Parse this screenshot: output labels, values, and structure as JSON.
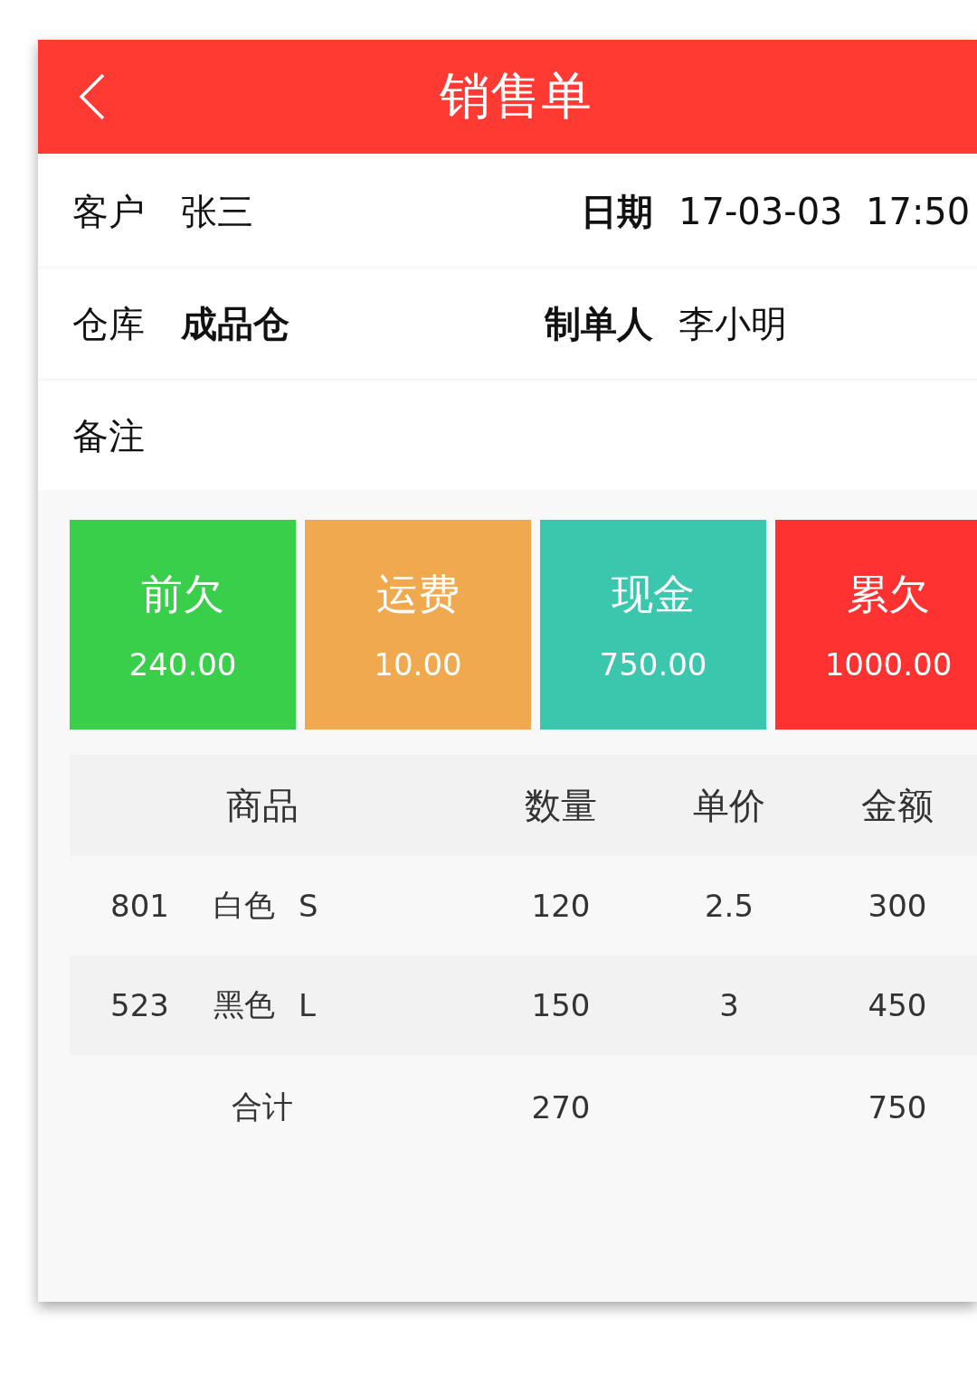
{
  "header": {
    "title": "销售单"
  },
  "info_rows": [
    {
      "left_label": "客户",
      "left_value": "张三",
      "right_label": "日期",
      "right_value": "17-03-03  17:50"
    },
    {
      "left_label": "仓库",
      "left_value": "成品仓",
      "right_label": "制单人",
      "right_value": "李小明"
    },
    {
      "left_label": "备注"
    }
  ],
  "summary_cards": [
    {
      "label": "前欠",
      "value": "240.00",
      "color": "#3acf4a"
    },
    {
      "label": "运费",
      "value": "10.00",
      "color": "#f0a94f"
    },
    {
      "label": "现金",
      "value": "750.00",
      "color": "#3bc7ae"
    },
    {
      "label": "累欠",
      "value": "1000.00",
      "color": "#ff3232"
    }
  ],
  "table": {
    "columns": [
      "商品",
      "数量",
      "单价",
      "金额"
    ],
    "rows": [
      {
        "code": "801",
        "color_name": "白色",
        "size": "S",
        "quantity": "120",
        "unit_price": "2.5",
        "amount": "300"
      },
      {
        "code": "523",
        "color_name": "黑色",
        "size": "L",
        "quantity": "150",
        "unit_price": "3",
        "amount": "450"
      }
    ],
    "total": {
      "label": "合计",
      "quantity": "270",
      "amount": "750"
    }
  }
}
